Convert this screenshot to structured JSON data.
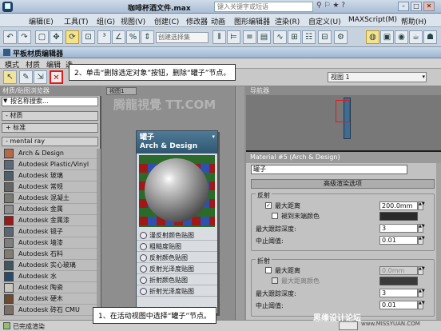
{
  "app": {
    "title": "咖啡杯酒文件.max",
    "search_placeholder": "键入关键字或短语",
    "menus": [
      "编辑(E)",
      "工具(T)",
      "组(G)",
      "视图(V)",
      "创建(C)",
      "修改器",
      "动画",
      "图形编辑器",
      "渲染(R)",
      "自定义(U)",
      "MAXScript(M)",
      "帮助(H)"
    ]
  },
  "toolbar": {
    "selection_set_placeholder": "创建选择集",
    "icons": [
      "undo-icon",
      "redo-icon",
      "link-icon",
      "unlink-icon",
      "bind-space-warp-icon",
      "select-icon",
      "move-icon",
      "rotate-icon",
      "scale-icon",
      "snap-3-icon",
      "angle-snap-icon",
      "percent-snap-icon",
      "spinner-snap-icon",
      "mirror-icon",
      "align-icon",
      "layer-icon",
      "curve-editor-icon",
      "schematic-icon",
      "material-editor-icon",
      "render-setup-icon",
      "render-frame-icon",
      "render-icon"
    ]
  },
  "mat_editor": {
    "title": "平板材质编辑器",
    "menus": [
      "模式",
      "材质",
      "编辑",
      "选"
    ],
    "view_dropdown": "视图 1",
    "browser_header": "材质/贴图浏览器",
    "search_placeholder": "按名称搜索...",
    "cat_materials": "- 材质",
    "cat_standard": "+ 标准",
    "cat_mental_ray": "- mental ray",
    "items": [
      {
        "label": "Arch & Design",
        "color": "#b36a4a"
      },
      {
        "label": "Autodesk Plastic/Vinyl",
        "color": "#5a6a7a"
      },
      {
        "label": "Autodesk 玻璃",
        "color": "#4e5f6c"
      },
      {
        "label": "Autodesk 常规",
        "color": "#646464"
      },
      {
        "label": "Autodesk 混凝土",
        "color": "#7a7a72"
      },
      {
        "label": "Autodesk 金属",
        "color": "#8e8e8e"
      },
      {
        "label": "Autodesk 金属漆",
        "color": "#9a1a1a"
      },
      {
        "label": "Autodesk 镜子",
        "color": "#5a6670"
      },
      {
        "label": "Autodesk 墙漆",
        "color": "#7f7f7f"
      },
      {
        "label": "Autodesk 石料",
        "color": "#807c72"
      },
      {
        "label": "Autodesk 实心玻璃",
        "color": "#41575f"
      },
      {
        "label": "Autodesk 水",
        "color": "#2b4a6a"
      },
      {
        "label": "Autodesk 陶瓷",
        "color": "#c9c6bd"
      },
      {
        "label": "Autodesk 硬木",
        "color": "#6b4a30"
      },
      {
        "label": "Autodesk 砖石 CMU",
        "color": "#7b6f66"
      }
    ],
    "view_tab": "视图1",
    "navigator_header": "导航器",
    "status_text": "已完成渲染"
  },
  "node": {
    "title": "罐子",
    "subtitle": "Arch & Design",
    "slots": [
      "漫反射颜色贴图",
      "粗糙度贴图",
      "反射颜色贴图",
      "反射光泽度贴图",
      "折射颜色贴图",
      "折射光泽度贴图"
    ]
  },
  "params": {
    "header": "Material #5 (Arch & Design)",
    "name_value": "罐子",
    "rollout": "高级渲染选项",
    "reflection": {
      "group": "反射",
      "max_distance_label": "最大距离",
      "max_distance_value": "200.0mm",
      "max_distance_checked": true,
      "fade_label": "褪到末端颜色",
      "max_trace_label": "最大跟踪深度:",
      "max_trace_value": "3",
      "cutoff_label": "中止阈值:",
      "cutoff_value": "0.01"
    },
    "refraction": {
      "group": "折射",
      "max_distance_label": "最大距离",
      "max_distance_value": "0.0mm",
      "fade_label": "最大距离颜色",
      "max_trace_label": "最大跟踪深度:",
      "max_trace_value": "3",
      "cutoff_label": "中止阈值:",
      "cutoff_value": "0.01"
    }
  },
  "callouts": {
    "step2": "2、单击“删除选定对象”按钮，删除“罐子”节点。",
    "step1": "1、在活动视图中选择“罐子”节点。"
  },
  "watermarks": {
    "top": "腾龍視覺 TT.COM",
    "bottom": "思缘设计论坛",
    "corner": "www.MISSYUAN.COM"
  },
  "colors": {
    "callout_border": "#333333",
    "highlight_red": "#e01b1b",
    "node_header": "#2e5670"
  }
}
